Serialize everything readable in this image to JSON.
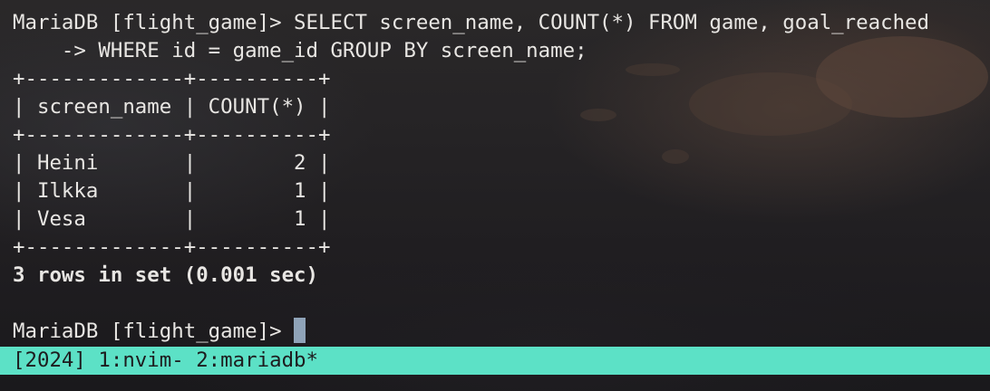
{
  "terminal": {
    "lines": [
      "MariaDB [flight_game]> SELECT screen_name, COUNT(*) FROM game, goal_reached",
      "    -> WHERE id = game_id GROUP BY screen_name;",
      "+-------------+----------+",
      "| screen_name | COUNT(*) |",
      "+-------------+----------+",
      "| Heini       |        2 |",
      "| Ilkka       |        1 |",
      "| Vesa        |        1 |",
      "+-------------+----------+",
      "3 rows in set (0.001 sec)",
      "",
      "MariaDB [flight_game]> "
    ]
  },
  "query_result": {
    "columns": [
      "screen_name",
      "COUNT(*)"
    ],
    "rows": [
      [
        "Heini",
        "2"
      ],
      [
        "Ilkka",
        "1"
      ],
      [
        "Vesa",
        "1"
      ]
    ],
    "summary": "3 rows in set (0.001 sec)"
  },
  "prompt": "MariaDB [flight_game]> ",
  "status_bar": {
    "text": "[2024] 1:nvim- 2:mariadb*"
  },
  "colors": {
    "text": "#e8e6e3",
    "cursor": "#8fa3b8",
    "status_bg": "#5ce1c6",
    "status_fg": "#1d1c1e"
  }
}
